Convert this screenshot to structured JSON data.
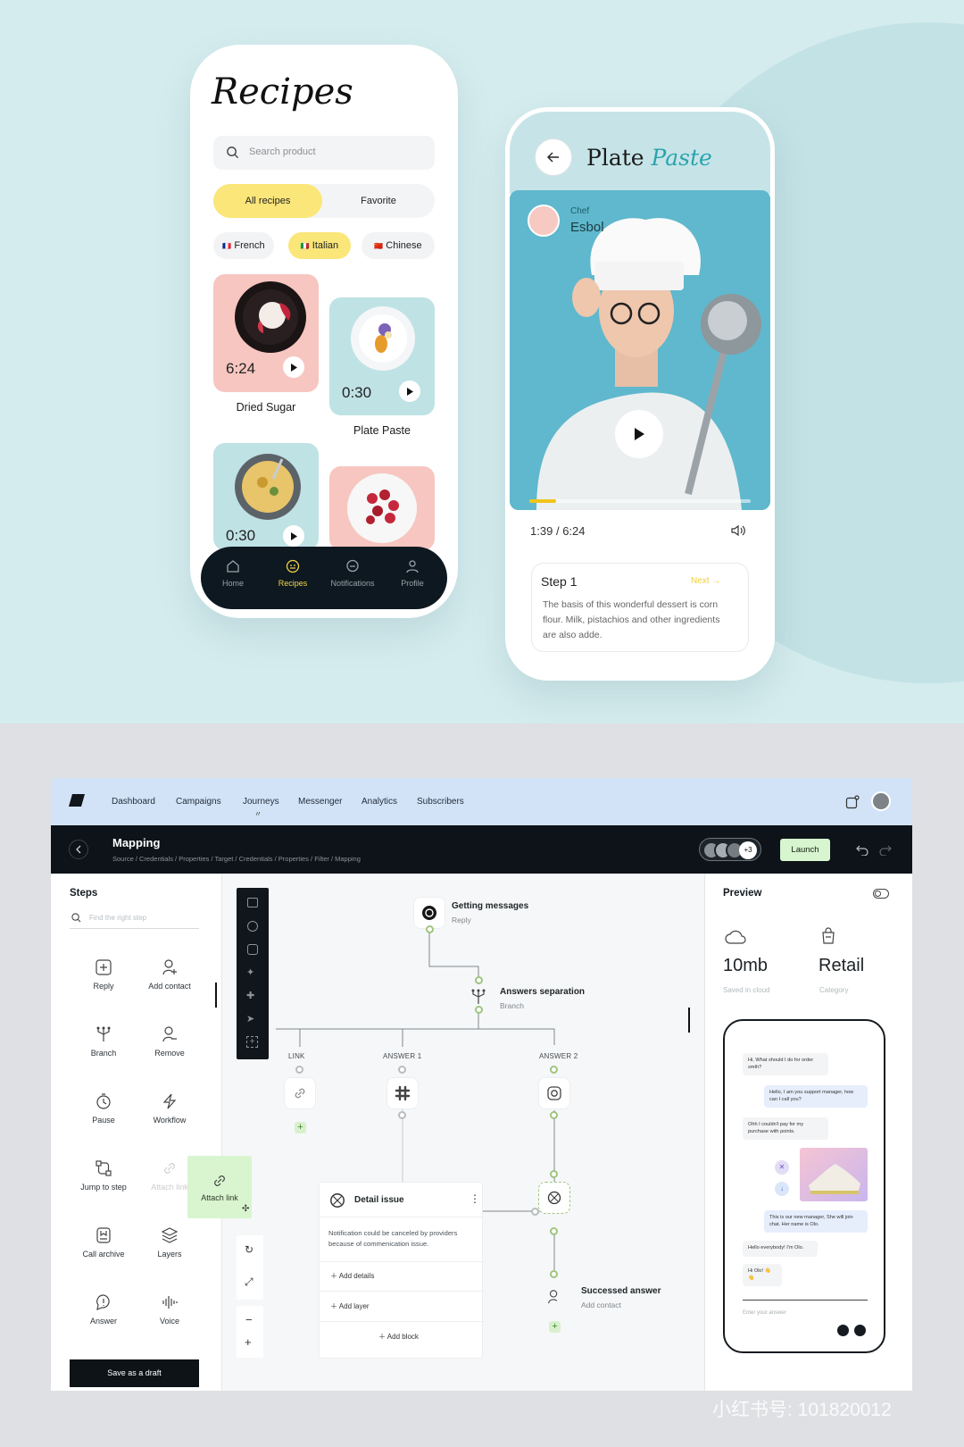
{
  "recipes_app": {
    "title": "Recipes",
    "search_placeholder": "Search product",
    "tabs": [
      {
        "label": "All recipes",
        "active": true
      },
      {
        "label": "Favorite",
        "active": false
      }
    ],
    "cuisines": [
      {
        "flag": "🇫🇷",
        "label": "French",
        "active": false
      },
      {
        "flag": "🇮🇹",
        "label": "Italian",
        "active": true
      },
      {
        "flag": "🇨🇳",
        "label": "Chinese",
        "active": false
      }
    ],
    "cards": [
      {
        "time": "6:24",
        "title": "Dried Sugar",
        "bg": "#f7c6c0"
      },
      {
        "time": "0:30",
        "title": "Plate Paste",
        "bg": "#bfe2e5"
      },
      {
        "time": "0:30",
        "title": "",
        "bg": "#bfe2e5"
      },
      {
        "time": "",
        "title": "",
        "bg": "#f7c6c0"
      }
    ],
    "bottom_nav": [
      {
        "label": "Home",
        "icon": "home-icon"
      },
      {
        "label": "Recipes",
        "icon": "recipes-icon",
        "active": true
      },
      {
        "label": "Notifications",
        "icon": "chat-icon"
      },
      {
        "label": "Profile",
        "icon": "profile-icon"
      }
    ]
  },
  "video_app": {
    "title_plain": "Plate",
    "title_script": "Paste",
    "chef_label": "Chef",
    "chef_name": "Esbol",
    "progress": 0.12,
    "time_current": "1:39",
    "time_separator": "/",
    "time_total": "6:24",
    "step_title": "Step 1",
    "next_label": "Next",
    "step_text": "The basis of this wonderful dessert is corn flour. Milk, pistachios and other ingredients are also adde."
  },
  "dashboard": {
    "nav": [
      "Dashboard",
      "Campaigns",
      "Journeys",
      "Messenger",
      "Analytics",
      "Subscribers"
    ],
    "header_title": "Mapping",
    "breadcrumb": "Source / Credentials / Properties / Target / Credentials / Properties / Filter / Mapping",
    "avatar_more": "+3",
    "launch_label": "Launch",
    "steps_title": "Steps",
    "steps_search_placeholder": "Find the right step",
    "steps": [
      {
        "label": "Reply",
        "icon": "reply-icon"
      },
      {
        "label": "Add contact",
        "icon": "add-contact-icon"
      },
      {
        "label": "Branch",
        "icon": "branch-icon"
      },
      {
        "label": "Remove",
        "icon": "remove-contact-icon"
      },
      {
        "label": "Pause",
        "icon": "pause-icon"
      },
      {
        "label": "Workflow",
        "icon": "bolt-icon"
      },
      {
        "label": "Jump to step",
        "icon": "jump-icon"
      },
      {
        "label": "Attach link",
        "icon": "link-icon"
      },
      {
        "label": "Call archive",
        "icon": "archive-icon"
      },
      {
        "label": "Layers",
        "icon": "layers-icon"
      },
      {
        "label": "Answer",
        "icon": "answer-icon"
      },
      {
        "label": "Voice",
        "icon": "voice-icon"
      }
    ],
    "drag_chip_label": "Attach link",
    "save_draft_label": "Save as a draft",
    "flow": {
      "getting_messages": {
        "title": "Getting messages",
        "subtitle": "Reply"
      },
      "answers_separation": {
        "title": "Answers separation",
        "subtitle": "Branch"
      },
      "branch_labels": [
        "LINK",
        "ANSWER 1",
        "ANSWER 2"
      ],
      "detail_issue": {
        "title": "Detail issue",
        "text": "Notification could be canceled by providers because of commenication issue.",
        "actions": [
          "Add details",
          "Add layer",
          "Add block"
        ]
      },
      "successed": {
        "title": "Successed answer",
        "subtitle": "Add contact"
      }
    },
    "preview": {
      "title": "Preview",
      "stats": [
        {
          "value": "10mb",
          "label": "Saved in cloud",
          "icon": "cloud-icon"
        },
        {
          "value": "Retail",
          "label": "Category",
          "icon": "bag-icon"
        }
      ],
      "messages": [
        {
          "side": "left",
          "text": "Hi, What should I do for order smth?"
        },
        {
          "side": "right",
          "text": "Hello, I am you support manager, how can I call you?"
        },
        {
          "side": "left",
          "text": "Ohh I couldn't pay for my purchase with points."
        },
        {
          "side": "right",
          "text": "This is our new manager, She will join chat. Her name is Olo."
        },
        {
          "side": "left",
          "text": "Hello everybody! I'm Olo."
        },
        {
          "side": "left",
          "text": "Hi Olo! 👋👋"
        }
      ],
      "input_placeholder": "Enter your answer"
    }
  },
  "watermark": "小红书号: 101820012",
  "colors": {
    "accent_yellow": "#fbe679",
    "launch_green": "#d7f5cf",
    "flow_green": "#9fc57f",
    "dark": "#0d1318"
  }
}
